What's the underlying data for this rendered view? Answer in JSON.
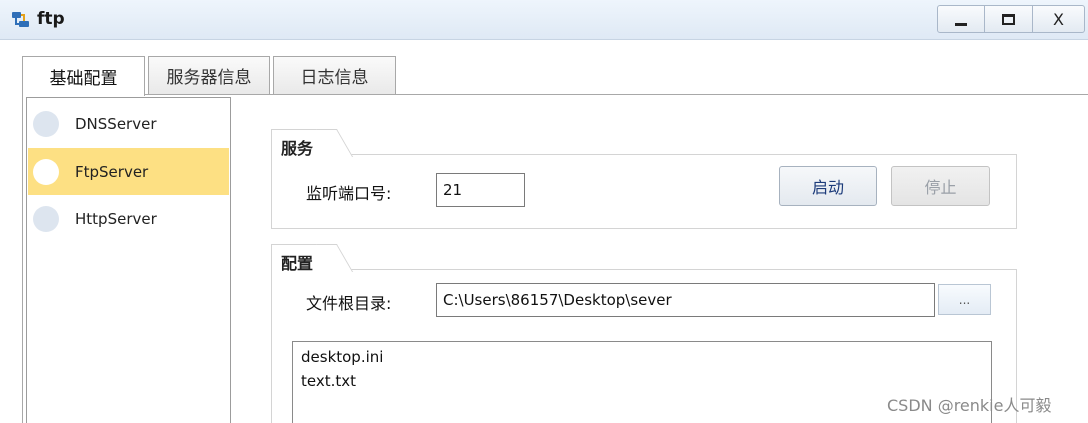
{
  "window": {
    "title": "ftp",
    "minimize_label": "_",
    "close_label": "X"
  },
  "tabs": [
    {
      "label": "基础配置",
      "active": true
    },
    {
      "label": "服务器信息",
      "active": false
    },
    {
      "label": "日志信息",
      "active": false
    }
  ],
  "sidebar": {
    "items": [
      {
        "label": "DNSServer",
        "selected": false
      },
      {
        "label": "FtpServer",
        "selected": true
      },
      {
        "label": "HttpServer",
        "selected": false
      }
    ]
  },
  "service": {
    "title": "服务",
    "port_label": "监听端口号:",
    "port_value": "21",
    "start_label": "启动",
    "stop_label": "停止"
  },
  "config": {
    "title": "配置",
    "root_label": "文件根目录:",
    "root_value": "C:\\Users\\86157\\Desktop\\sever",
    "browse_label": "...",
    "files": [
      "desktop.ini",
      "text.txt"
    ]
  },
  "watermark": "CSDN @renkie人可毅",
  "colors": {
    "selected_item": "#fde083",
    "titlebar": "#dfe9f5",
    "accent_text": "#1c3b7a"
  }
}
